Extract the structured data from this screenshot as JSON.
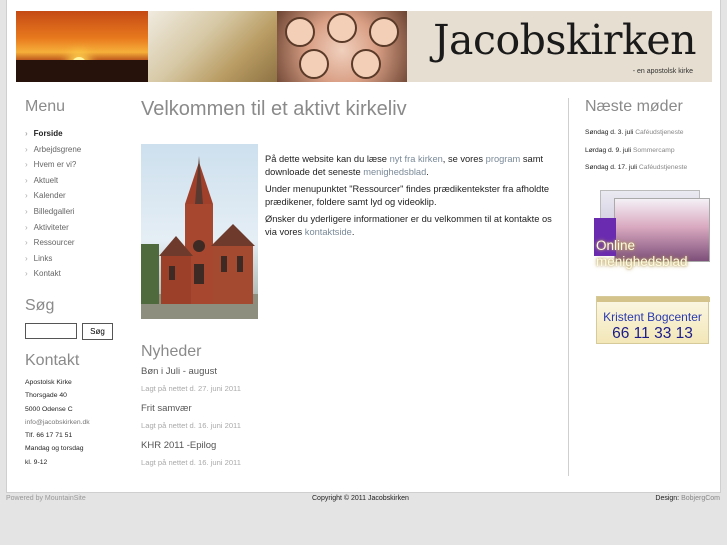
{
  "banner": {
    "title": "Jacobskirken",
    "tagline": "- en apostolsk kirke"
  },
  "menu": {
    "heading": "Menu",
    "items": [
      {
        "label": "Forside",
        "active": true
      },
      {
        "label": "Arbejdsgrene"
      },
      {
        "label": "Hvem er vi?"
      },
      {
        "label": "Aktuelt"
      },
      {
        "label": "Kalender"
      },
      {
        "label": "Billedgalleri"
      },
      {
        "label": "Aktiviteter"
      },
      {
        "label": "Ressourcer"
      },
      {
        "label": "Links"
      },
      {
        "label": "Kontakt"
      }
    ],
    "arrow": "›"
  },
  "search": {
    "heading": "Søg",
    "placeholder": "",
    "button_label": "Søg"
  },
  "contact": {
    "heading": "Kontakt",
    "lines": [
      "Apostolsk Kirke",
      "Thorsgade 40",
      "5000 Odense C",
      "info@jacobskirken.dk",
      "Tlf. 66 17 71 51",
      "Mandag og torsdag",
      "kl. 9-12"
    ]
  },
  "main": {
    "title": "Velkommen til et aktivt kirkeliv",
    "intro": {
      "p1_a": "På dette website kan du læse ",
      "p1_link1": "nyt fra kirken",
      "p1_b": ", se vores ",
      "p1_link2": "program",
      "p1_c": " samt downloade det seneste ",
      "p1_link3": "menighedsblad",
      "p1_d": ".",
      "p2": "Under menupunktet \"Ressourcer\" findes prædikentekster fra afholdte prædikener, foldere samt lyd og videoklip.",
      "p3_a": "Ønsker du yderligere informationer er du velkommen til at kontakte os via vores ",
      "p3_link": "kontaktside",
      "p3_b": "."
    },
    "news_heading": "Nyheder",
    "news": [
      {
        "title": "Bøn i Juli - august",
        "date": "Lagt på nettet d. 27. juni 2011"
      },
      {
        "title": "Frit samvær",
        "date": "Lagt på nettet d. 16. juni 2011"
      },
      {
        "title": "KHR 2011 -Epilog",
        "date": "Lagt på nettet d. 16. juni 2011"
      }
    ]
  },
  "next_meetings": {
    "heading": "Næste møder",
    "items": [
      {
        "day": "Søndag d. 3. juli",
        "event": "Caféudstjeneste"
      },
      {
        "day": "Lørdag d. 9. juli",
        "event": "Sommercamp"
      },
      {
        "day": "Søndag d. 17. juli",
        "event": "Caféudstjeneste"
      }
    ]
  },
  "ads": {
    "magazine_line1": "Online",
    "magazine_line2": "menighedsblad",
    "bogcenter_name": "Kristent Bogcenter",
    "bogcenter_phone": "66 11 33 13"
  },
  "footer": {
    "left": "Powered by  MountainSite",
    "center": "Copyright © 2011 Jacobskirken",
    "right_label": "Design: ",
    "right_link": "BobjergCom"
  }
}
